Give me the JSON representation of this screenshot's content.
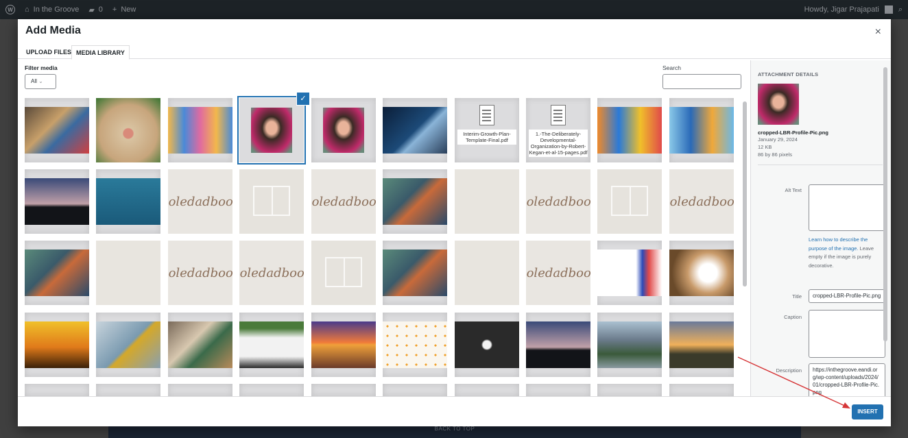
{
  "admin_bar": {
    "site_name": "In the Groove",
    "comments_count": "0",
    "new_label": "New",
    "greeting": "Howdy, Jigar Prajapati"
  },
  "back_to_top": "BACK TO TOP",
  "modal": {
    "title": "Add Media",
    "close_label": "×",
    "tabs": [
      {
        "label": "UPLOAD FILES",
        "active": false
      },
      {
        "label": "MEDIA LIBRARY",
        "active": true
      }
    ]
  },
  "filter": {
    "label": "Filter media",
    "value": "All"
  },
  "search": {
    "label": "Search",
    "placeholder": ""
  },
  "library": {
    "rows": [
      [
        {
          "type": "photo",
          "subject": "feedback-letters"
        },
        {
          "type": "photo",
          "subject": "dog-face"
        },
        {
          "type": "photo",
          "subject": "flower-banner"
        },
        {
          "type": "photo",
          "subject": "profile-portrait",
          "selected": true
        },
        {
          "type": "photo",
          "subject": "profile-portrait"
        },
        {
          "type": "photo",
          "subject": "business-growth"
        },
        {
          "type": "file",
          "name": "Interim-Growth-Plan-Template-Final.pdf"
        },
        {
          "type": "file",
          "name": "1.-The-Deliberately-Developmental-Organization-by-Robert-Kegan-et-al-15-pages.pdf"
        },
        {
          "type": "photo",
          "subject": "in-the-groove-banner-orange"
        },
        {
          "type": "photo",
          "subject": "in-the-groove-banner-blue"
        }
      ],
      [
        {
          "type": "photo",
          "subject": "dusk-hill"
        },
        {
          "type": "photo",
          "subject": "what-do-you-think-sign"
        },
        {
          "type": "script",
          "text": "Soledadbook"
        },
        {
          "type": "photo",
          "subject": "book-placeholder"
        },
        {
          "type": "script",
          "text": "Soledadbook"
        },
        {
          "type": "photo",
          "subject": "reading-on-floor"
        },
        {
          "type": "photo",
          "subject": "blank-beige"
        },
        {
          "type": "script",
          "text": "Soledadbook"
        },
        {
          "type": "photo",
          "subject": "book-placeholder"
        },
        {
          "type": "script",
          "text": "Soledadbook"
        }
      ],
      [
        {
          "type": "photo",
          "subject": "reading-on-floor"
        },
        {
          "type": "photo",
          "subject": "blank-beige"
        },
        {
          "type": "script",
          "text": "Soledadbook"
        },
        {
          "type": "script",
          "text": "Soledadbook"
        },
        {
          "type": "photo",
          "subject": "book-placeholder"
        },
        {
          "type": "photo",
          "subject": "reading-on-floor"
        },
        {
          "type": "photo",
          "subject": "blank-beige"
        },
        {
          "type": "script",
          "text": "Soledadbook"
        },
        {
          "type": "photo",
          "subject": "banner-strip"
        },
        {
          "type": "photo",
          "subject": "white-flower-petals"
        }
      ],
      [
        {
          "type": "photo",
          "subject": "sunset-palms"
        },
        {
          "type": "photo",
          "subject": "folded-shirt"
        },
        {
          "type": "photo",
          "subject": "team-meeting-table"
        },
        {
          "type": "photo",
          "subject": "welcome-lightbox"
        },
        {
          "type": "photo",
          "subject": "bridge-sunset"
        },
        {
          "type": "photo",
          "subject": "confetti-pattern"
        },
        {
          "type": "photo",
          "subject": "lightbulb-mindmap"
        },
        {
          "type": "photo",
          "subject": "dusk-hill"
        },
        {
          "type": "photo",
          "subject": "lake-mountains"
        },
        {
          "type": "photo",
          "subject": "field-sunset"
        }
      ]
    ]
  },
  "attachment_details": {
    "heading": "ATTACHMENT DETAILS",
    "filename": "cropped-LBR-Profile-Pic.png",
    "date": "January 29, 2024",
    "size": "12 KB",
    "dimensions": "86 by 86 pixels",
    "alt_text_label": "Alt Text",
    "alt_text_value": "",
    "help_link": "Learn how to describe the purpose of the image.",
    "help_rest": "Leave empty if the image is purely decorative.",
    "title_label": "Title",
    "title_value": "cropped-LBR-Profile-Pic.png",
    "caption_label": "Caption",
    "caption_value": "",
    "description_label": "Description",
    "description_value": "https://inthegroove.eandi.org/wp-content/uploads/2024/01/cropped-LBR-Profile-Pic.png"
  },
  "insert_label": "INSERT",
  "colors": {
    "accent": "#2271b1",
    "annotation_arrow": "#d63638"
  }
}
